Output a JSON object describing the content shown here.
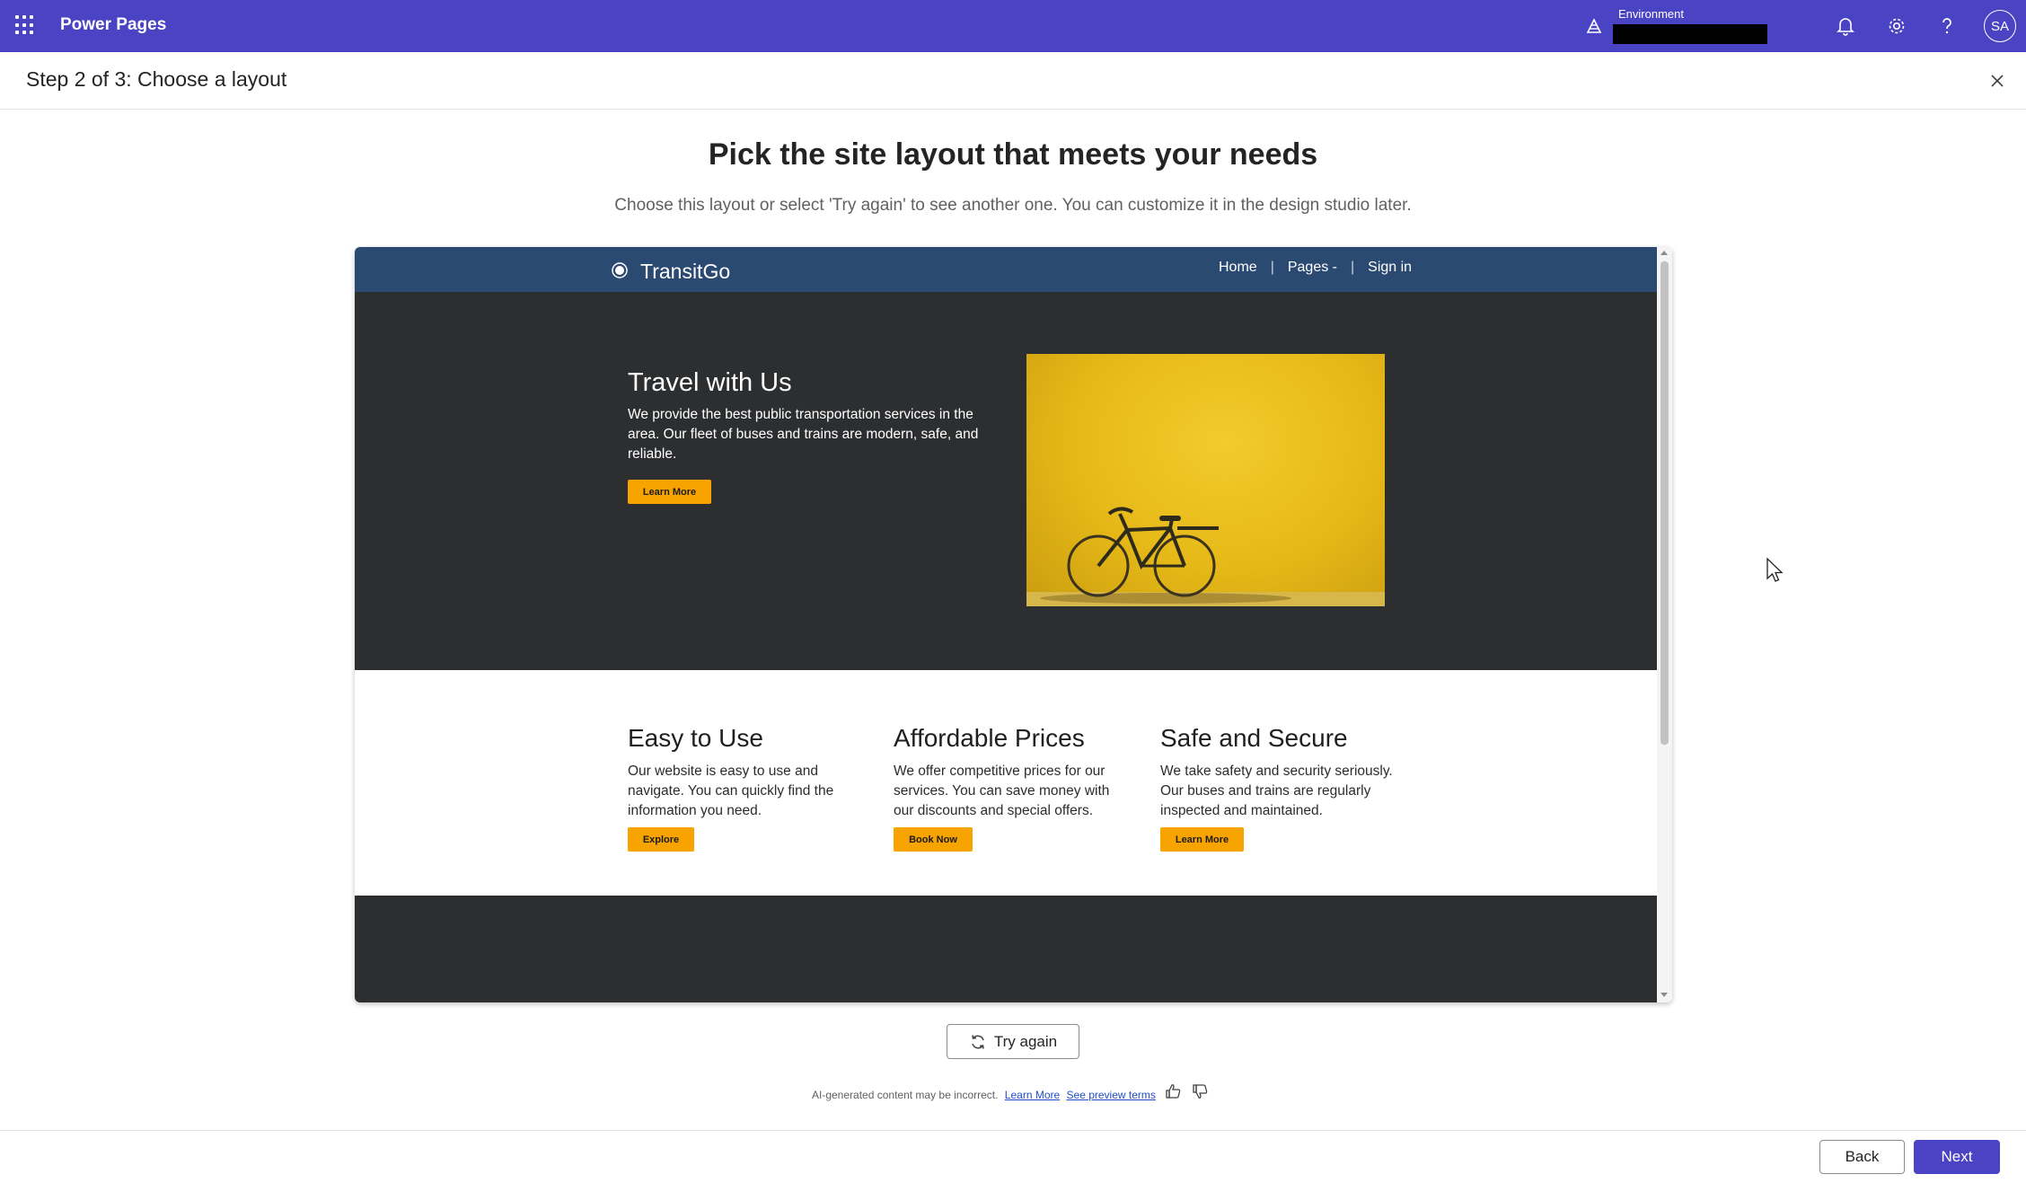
{
  "topbar": {
    "app_title": "Power Pages",
    "environment_label": "Environment",
    "environment_value": "",
    "avatar_initials": "SA",
    "icons": [
      "waffle-icon",
      "environment-icon",
      "bell-icon",
      "gear-icon",
      "help-icon"
    ]
  },
  "wizard": {
    "step_title": "Step 2 of 3: Choose a layout",
    "heading": "Pick the site layout that meets your needs",
    "subheading": "Choose this layout or select 'Try again' to see another one. You can customize it in the design studio later."
  },
  "preview": {
    "brand": "TransitGo",
    "nav": [
      "Home",
      "Pages -",
      "Sign in"
    ],
    "hero": {
      "title": "Travel with Us",
      "text": "We provide the best public transportation services in the area. Our fleet of buses and trains are modern, safe, and reliable.",
      "button": "Learn More"
    },
    "features": [
      {
        "title": "Easy to Use",
        "text": "Our website is easy to use and navigate. You can quickly find the information you need.",
        "button": "Explore"
      },
      {
        "title": "Affordable Prices",
        "text": "We offer competitive prices for our services. You can save money with our discounts and special offers.",
        "button": "Book Now"
      },
      {
        "title": "Safe and Secure",
        "text": "We take safety and security seriously. Our buses and trains are regularly inspected and maintained.",
        "button": "Learn More"
      }
    ]
  },
  "actions": {
    "try_again": "Try again",
    "disclaimer": "AI-generated content may be incorrect.",
    "learn_more_link": "Learn More",
    "preview_terms_link": "See preview terms",
    "back": "Back",
    "next": "Next"
  },
  "colors": {
    "brand": "#4a43c4",
    "preview_nav": "#2b4a72",
    "preview_dark": "#2c2e30",
    "accent_orange": "#f7a300"
  }
}
